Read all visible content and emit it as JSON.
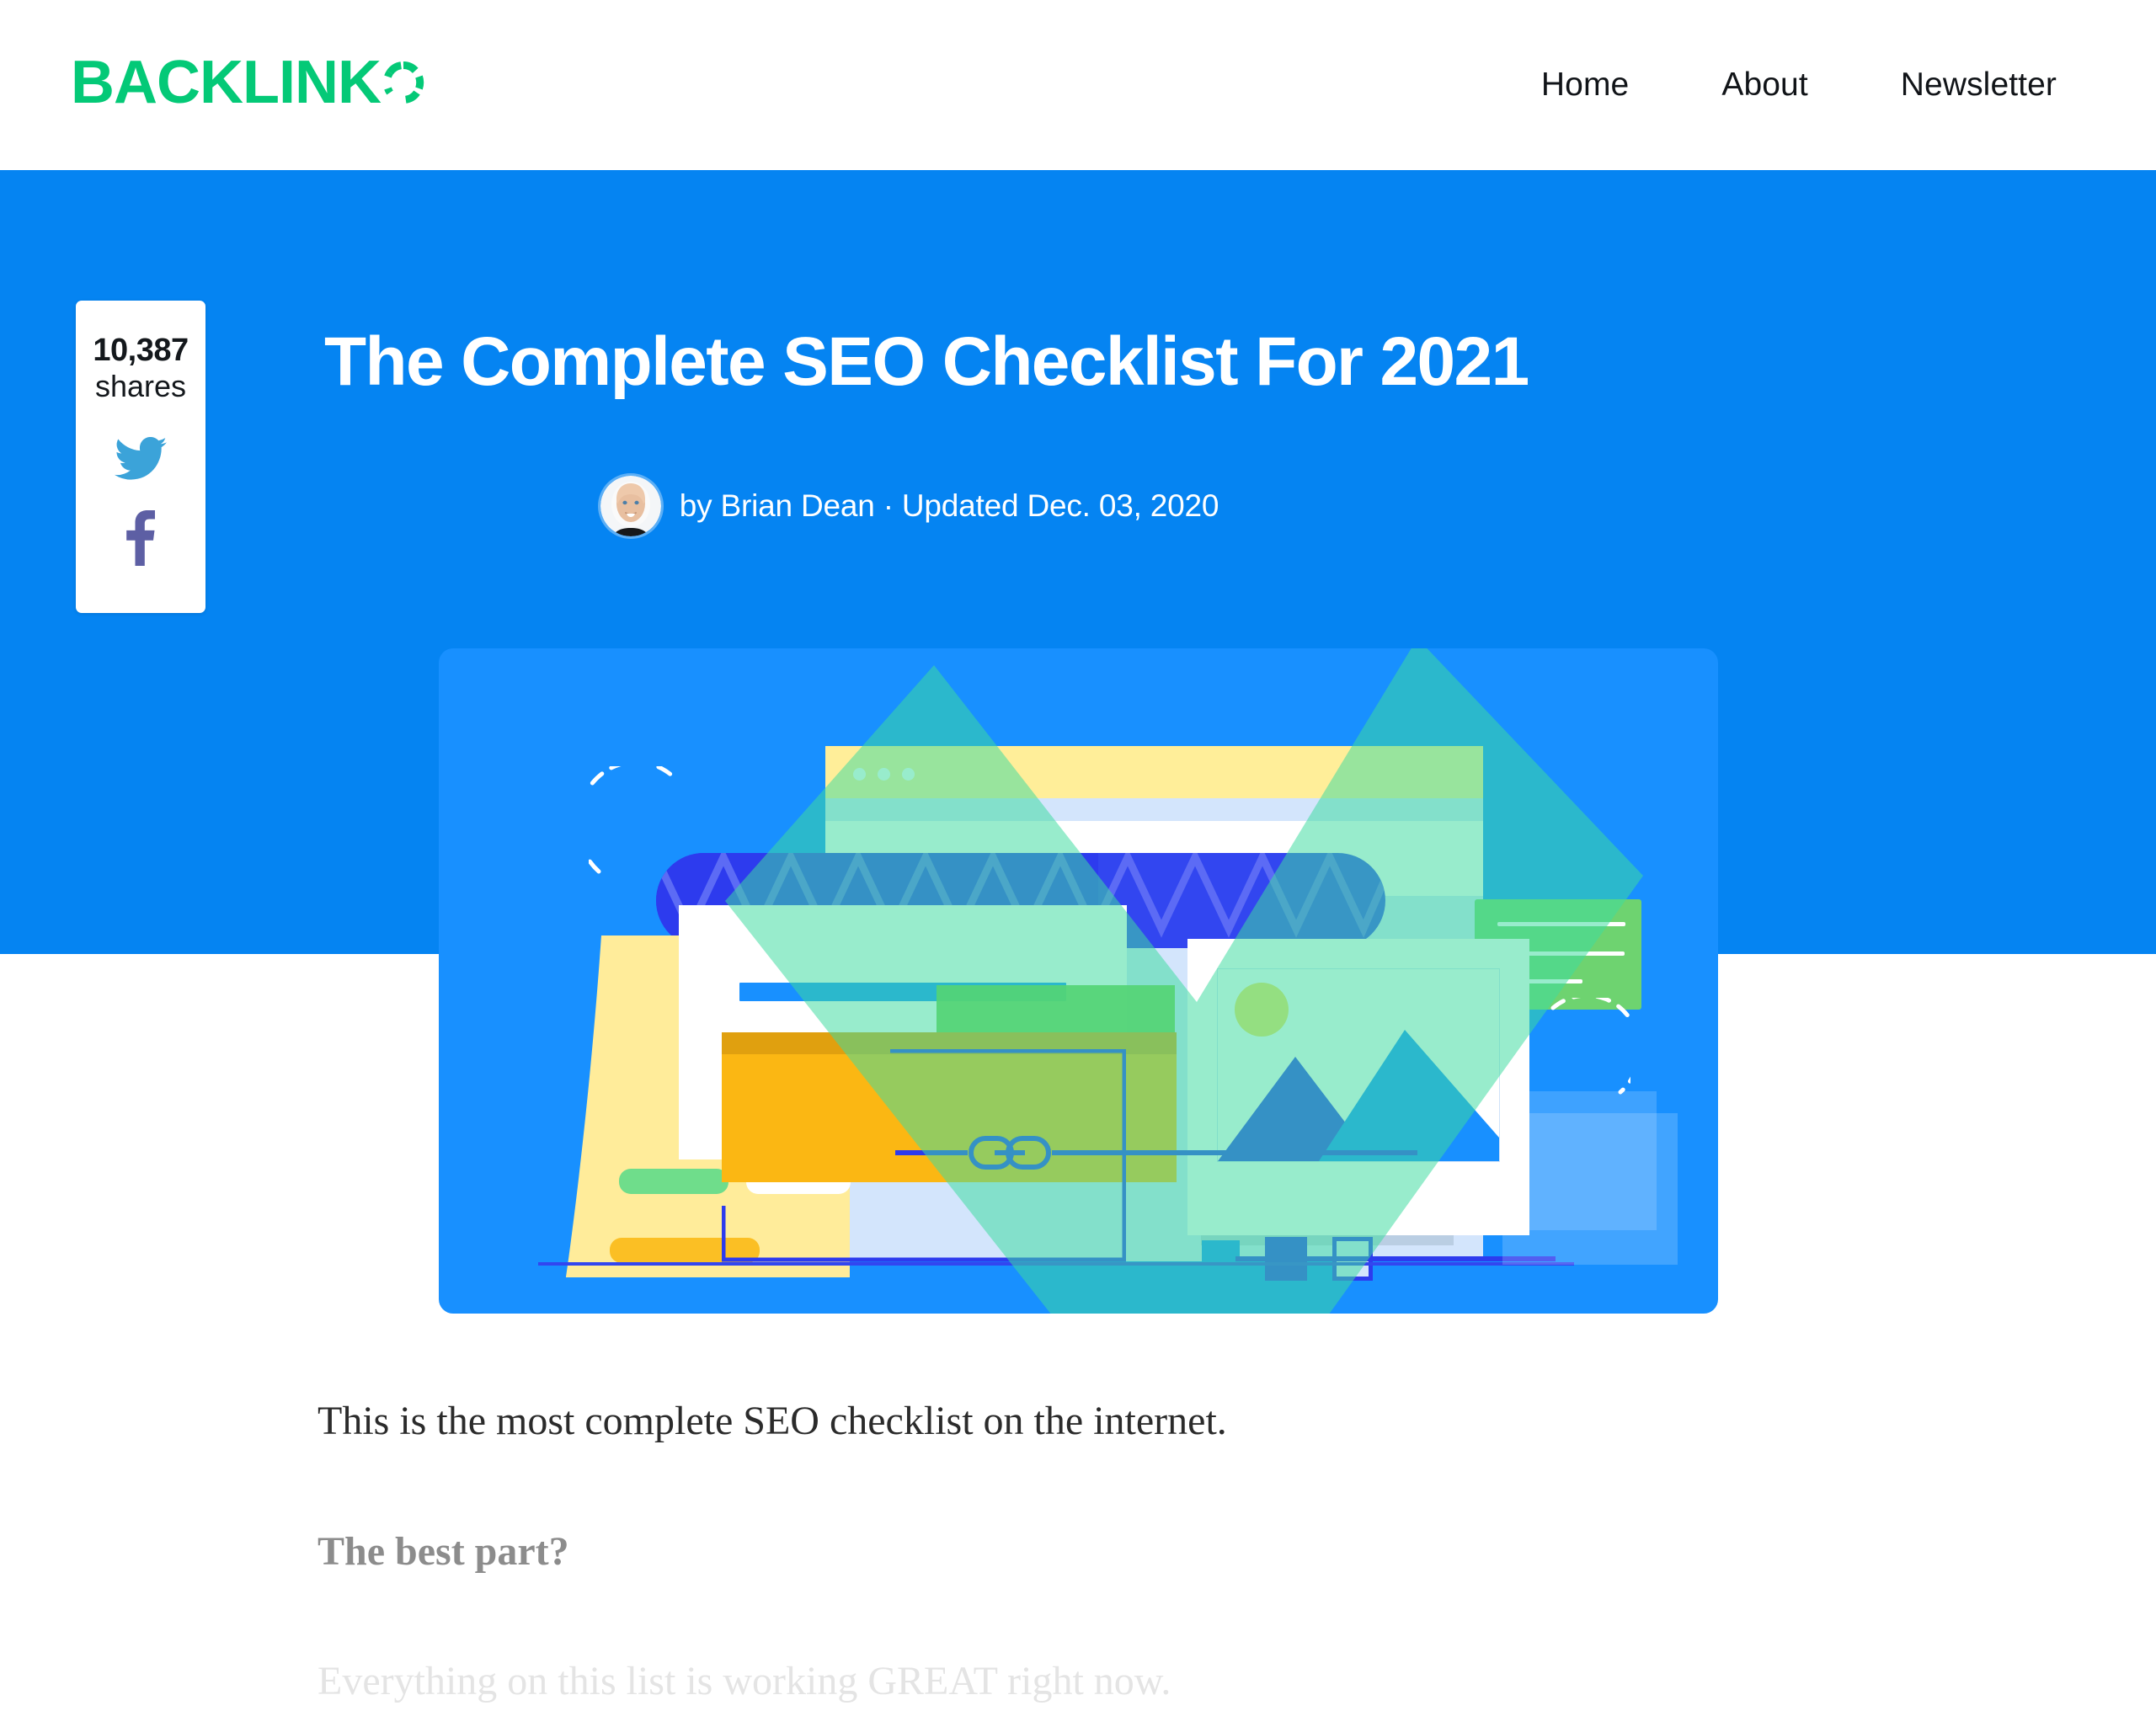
{
  "site": {
    "logo_text": "BACKLINK",
    "logo_icon": "segmented-ring-o",
    "logo_color": "#04C977"
  },
  "nav": {
    "items": [
      {
        "label": "Home"
      },
      {
        "label": "About"
      },
      {
        "label": "Newsletter"
      }
    ]
  },
  "share": {
    "count": "10,387",
    "label": "shares",
    "twitter_icon": "twitter-bird-icon",
    "twitter_color": "#3BA3D9",
    "facebook_icon": "facebook-f-icon",
    "facebook_color": "#5D5FA4"
  },
  "hero": {
    "background_color": "#0584F2",
    "title": "The Complete SEO Checklist For 2021",
    "byline": "by Brian Dean · Updated Dec. 03, 2020",
    "author_name": "Brian Dean",
    "updated_date": "Dec. 03, 2020",
    "avatar_alt": "Brian Dean headshot"
  },
  "illustration": {
    "alt": "SEO checklist illustration with browser window, search bar, cards and a large green checkmark",
    "background_color": "#1890FF",
    "checkmark_color": "#3DDCA0",
    "accent_yellow": "#FFEE99",
    "accent_orange": "#FBB713",
    "accent_green": "#6FCB45",
    "accent_blue": "#2D3BEE"
  },
  "article": {
    "paragraphs": [
      {
        "text": "This is the most complete SEO checklist on the internet.",
        "style": "body"
      },
      {
        "text": "The best part?",
        "style": "subhead"
      },
      {
        "text": "Everything on this list is working GREAT right now.",
        "style": "faded"
      }
    ]
  }
}
